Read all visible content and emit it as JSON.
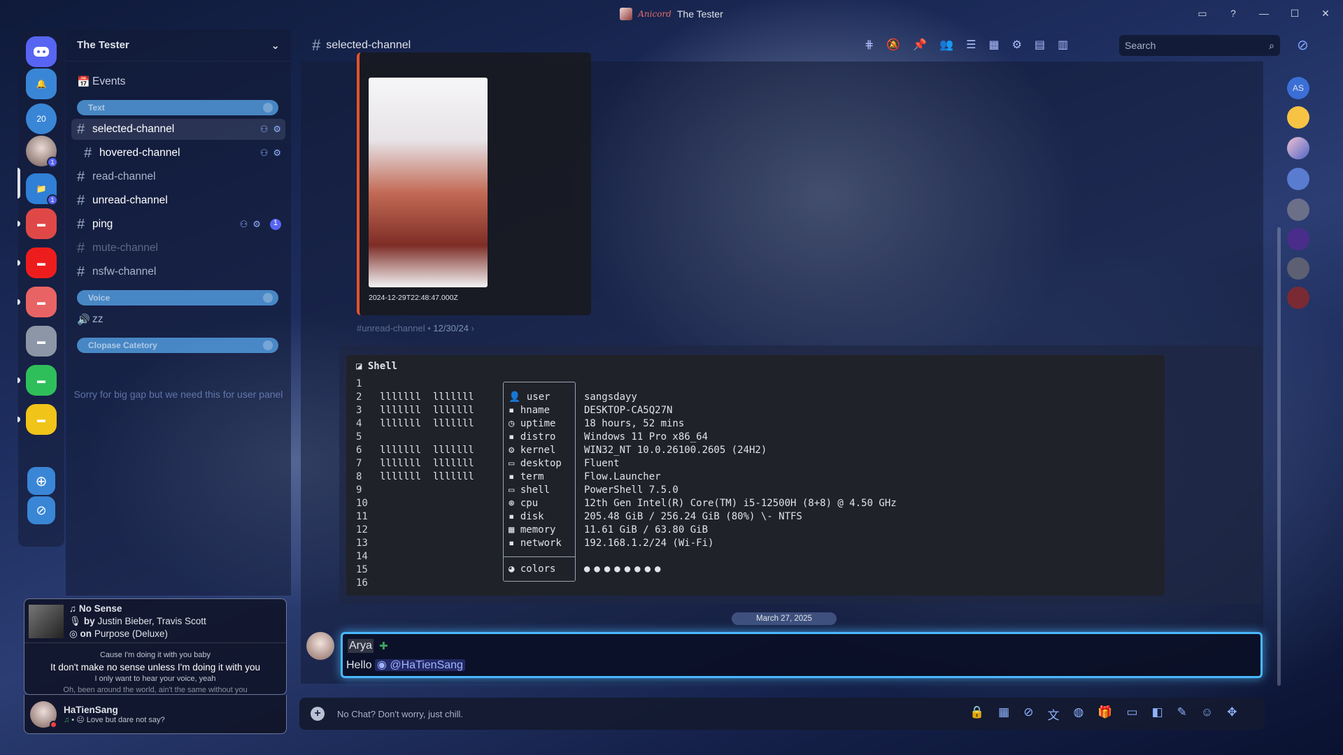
{
  "window": {
    "app_name": "Anicord",
    "title": "The Tester",
    "controls": [
      "inbox-icon",
      "help-icon",
      "minimize-icon",
      "maximize-icon",
      "close-icon"
    ]
  },
  "rail": {
    "notification_count": "20",
    "badges": [
      "1",
      "1"
    ]
  },
  "guild": {
    "name": "The Tester",
    "events_label": "Events",
    "categories": {
      "text": "Text",
      "voice": "Voice",
      "collapse": "Clopase Catetory"
    },
    "channels": [
      {
        "name": "selected-channel",
        "state": "selected"
      },
      {
        "name": "hovered-channel",
        "state": "hovered"
      },
      {
        "name": "read-channel",
        "state": "read"
      },
      {
        "name": "unread-channel",
        "state": "unread"
      },
      {
        "name": "ping",
        "state": "ping",
        "badge": "1"
      },
      {
        "name": "mute-channel",
        "state": "muted"
      },
      {
        "name": "nsfw-channel",
        "state": "read"
      }
    ],
    "voice_channel": "zz",
    "gap_note": "Sorry for big gap but we need this for user panel"
  },
  "music": {
    "track": "No Sense",
    "artists_prefix": "by",
    "artists": "Justin Bieber, Travis Scott",
    "album_prefix": "on",
    "album": "Purpose (Deluxe)",
    "lyric_prev": "Cause I'm doing it with you baby",
    "lyric_current": "It don't make no sense unless I'm doing it with you",
    "lyric_next": "I only want to hear your voice, yeah",
    "lyric_next2": "Oh, been around the world, ain't the same without you"
  },
  "user_panel": {
    "username": "HaTienSang",
    "status": "Love but dare not say?"
  },
  "header": {
    "channel_name": "selected-channel",
    "search_placeholder": "Search",
    "tools": [
      "threads-icon",
      "mute-icon",
      "pin-icon",
      "members-icon",
      "forum-icon",
      "calendar-icon",
      "settings-icon",
      "notes-icon",
      "bookmark-icon"
    ]
  },
  "old_message": {
    "timestamp": "2024-12-29T22:48:47.000Z",
    "reply_channel": "#unread-channel",
    "reply_date": "12/30/24"
  },
  "shell": {
    "title": "Shell",
    "line_numbers": [
      "1",
      "2",
      "3",
      "4",
      "5",
      "6",
      "7",
      "8",
      "9",
      "10",
      "11",
      "12",
      "13",
      "14",
      "15",
      "16"
    ],
    "logo_rows": [
      "lllllll  lllllll",
      "lllllll  lllllll",
      "lllllll  lllllll",
      "",
      "lllllll  lllllll",
      "lllllll  lllllll",
      "lllllll  lllllll"
    ],
    "keys": [
      "user",
      "hname",
      "uptime",
      "distro",
      "kernel",
      "desktop",
      "term",
      "shell",
      "cpu",
      "disk",
      "memory",
      "network"
    ],
    "values": [
      "sangsdayy",
      "DESKTOP-CA5Q27N",
      "18 hours, 52 mins",
      "Windows 11 Pro x86_64",
      "WIN32_NT 10.0.26100.2605 (24H2)",
      "Fluent",
      "Flow.Launcher",
      "PowerShell 7.5.0",
      "12th Gen Intel(R) Core(TM) i5-12500H (8+8) @ 4.50 GHz",
      "205.48 GiB / 256.24 GiB (80%) \\- NTFS",
      "11.61 GiB / 63.80 GiB",
      "192.168.1.2/24 (Wi-Fi)"
    ],
    "colors_key": "colors",
    "color_dots": "●●●●●●●●"
  },
  "new_message": {
    "day_divider": "March 27, 2025",
    "author": "Arya",
    "text": "Hello",
    "mention": "@HaTienSang"
  },
  "composer": {
    "placeholder": "No Chat? Don't worry, just chill."
  },
  "members": {
    "first_initials": "AS"
  }
}
